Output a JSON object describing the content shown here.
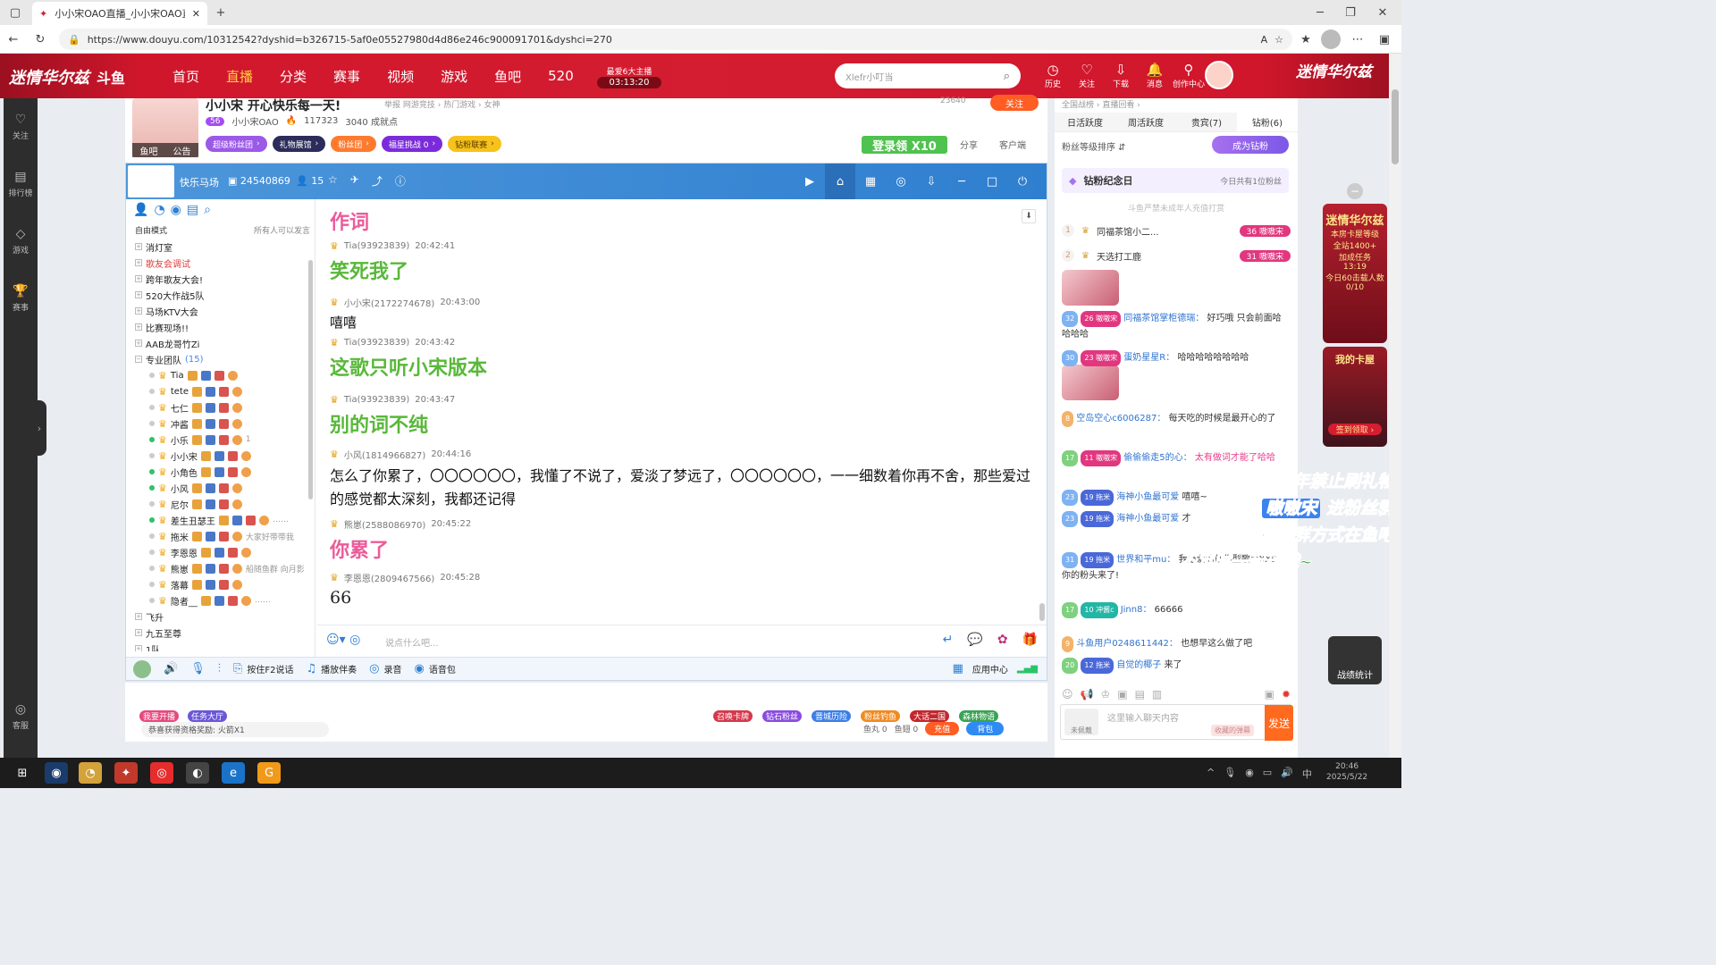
{
  "browser": {
    "tab_title": "小小宋OAO直播_小小宋OAO直播",
    "url": "https://www.douyu.com/10312542?dyshid=b326715-5af0e05527980d4d86e246c900091701&dyshci=270"
  },
  "header": {
    "banner_left": "迷情华尔兹",
    "logo": "斗鱼",
    "nav": [
      "首页",
      "直播",
      "分类",
      "赛事",
      "视频",
      "游戏",
      "鱼吧",
      "520"
    ],
    "active_nav": "直播",
    "timer_label": "最爱6大主播",
    "timer_value": "03:13:20",
    "search_placeholder": "Xlefr小叮当",
    "tools": [
      {
        "icon": "history-icon",
        "label": "历史"
      },
      {
        "icon": "heart-icon",
        "label": "关注"
      },
      {
        "icon": "download-icon",
        "label": "下载"
      },
      {
        "icon": "bell-icon",
        "label": "消息"
      },
      {
        "icon": "creator-icon",
        "label": "创作中心"
      }
    ],
    "banner_right": "迷情华尔兹"
  },
  "leftbar": [
    {
      "icon": "heart-icon",
      "label": "关注"
    },
    {
      "icon": "rank-icon",
      "label": "排行榜"
    },
    {
      "icon": "game-icon",
      "label": "游戏"
    },
    {
      "icon": "trophy-icon",
      "label": "赛事"
    },
    {
      "icon": "headset-icon",
      "label": "客服"
    }
  ],
  "room": {
    "title": "小小宋 开心快乐每一天!",
    "meta": "举报   网游竞技 › 热门游戏 › 女神",
    "host_level": "56",
    "host_name": "小小宋OAO",
    "heat": "117323",
    "achievements": "3040 成就点",
    "follow_count": "23640",
    "follow_label": "关注",
    "avatar_caption_left": "鱼吧",
    "avatar_caption_right": "公告",
    "pills": [
      "超级粉丝团",
      "礼物展馆",
      "粉丝团",
      "福星挑战  0",
      "钻粉联赛"
    ],
    "login_promo": "登录领 X10",
    "share": "分享",
    "service": "客户端"
  },
  "chatwin": {
    "room_name": "快乐马场",
    "room_id": "24540869",
    "member_count": "15",
    "mode_label": "自由模式",
    "mode_right": "所有人可以发言",
    "members": [
      {
        "name": "消灯室",
        "type": "folder"
      },
      {
        "name": "歌友会调试",
        "type": "folder",
        "red": true
      },
      {
        "name": "跨年歌友大会!",
        "type": "folder"
      },
      {
        "name": "520大作战5队",
        "type": "folder"
      },
      {
        "name": "马场KTV大会",
        "type": "folder"
      },
      {
        "name": "比赛现场!!",
        "type": "folder"
      },
      {
        "name": "AAB龙哥竹Zi",
        "type": "folder"
      },
      {
        "name": "专业团队",
        "type": "group",
        "count": "(15)"
      },
      {
        "name": "Tia",
        "online": false,
        "note": ""
      },
      {
        "name": "tete",
        "online": false,
        "note": ""
      },
      {
        "name": "七仁",
        "online": false,
        "note": ""
      },
      {
        "name": "冲酱",
        "online": false,
        "note": ""
      },
      {
        "name": "小乐",
        "online": true,
        "note": "1"
      },
      {
        "name": "小小宋",
        "online": false,
        "note": ""
      },
      {
        "name": "小角色",
        "online": true,
        "note": ""
      },
      {
        "name": "小风",
        "online": true,
        "note": ""
      },
      {
        "name": "尼尔",
        "online": false,
        "note": ""
      },
      {
        "name": "差生丑瑟王",
        "online": true,
        "note": "……"
      },
      {
        "name": "拖米",
        "online": false,
        "note": "大家好带带我"
      },
      {
        "name": "李恩恩",
        "online": false,
        "note": ""
      },
      {
        "name": "熊崽",
        "online": false,
        "note": "船随鱼群 向月影"
      },
      {
        "name": "落幕",
        "online": false,
        "note": ""
      },
      {
        "name": "隐者__",
        "online": false,
        "note": "……"
      },
      {
        "name": "飞升",
        "type": "folder"
      },
      {
        "name": "九五至尊",
        "type": "folder"
      },
      {
        "name": "1队",
        "type": "folder"
      }
    ],
    "messages": [
      {
        "user": "",
        "time": "",
        "text": "作词",
        "style": "pink"
      },
      {
        "user": "Tia(93923839)",
        "time": "20:42:41",
        "text": "笑死我了",
        "style": "green"
      },
      {
        "user": "小小宋(2172274678)",
        "time": "20:43:00",
        "text": "嘻嘻",
        "style": "plain"
      },
      {
        "user": "Tia(93923839)",
        "time": "20:43:42",
        "text": "这歌只听小宋版本",
        "style": "green"
      },
      {
        "user": "Tia(93923839)",
        "time": "20:43:47",
        "text": "别的词不纯",
        "style": "green"
      },
      {
        "user": "小风(1814966827)",
        "time": "20:44:16",
        "text": "怎么了你累了，〇〇〇〇〇〇，我懂了不说了，爱淡了梦远了，〇〇〇〇〇〇，一一细数着你再不舍，那些爱过的感觉都太深刻，我都还记得",
        "style": "long"
      },
      {
        "user": "熊崽(2588086970)",
        "time": "20:45:22",
        "text": "你累了",
        "style": "pink"
      },
      {
        "user": "李恩恩(2809467566)",
        "time": "20:45:28",
        "text": "66",
        "style": "x"
      }
    ],
    "input_placeholder": "说点什么吧...",
    "tools": [
      "按住F2说话",
      "播放伴奏",
      "录音",
      "语音包"
    ],
    "app_center": "应用中心"
  },
  "giftbar": {
    "left_buttons": [
      "我要开播",
      "任务大厅"
    ],
    "gifts": [
      "召唤卡牌",
      "钻石粉丝",
      "晋城历险",
      "粉丝钓鱼",
      "大话二国",
      "森林物语"
    ],
    "reward_text": "恭喜获得资格奖励: 火箭X1",
    "fish_balls": "鱼丸 0",
    "fish_fins": "鱼翅 0",
    "recharge": "充值",
    "backpack": "背包"
  },
  "rightpanel": {
    "top_links": "全国战榜 ›        直播回看 ›",
    "tabs": [
      "日活跃度",
      "周活跃度",
      "贵宾(7)",
      "钻粉(6)"
    ],
    "active_tab": "钻粉(6)",
    "sort_label": "粉丝等级排序 ⇵",
    "fan_btn": "成为钻粉",
    "day_title": "钻粉纪念日",
    "day_right": "今日共有1位粉丝",
    "minor_notice": "斗鱼严禁未成年人充值打赏",
    "ranks": [
      {
        "n": "1",
        "name": "同福茶馆小二...",
        "tag": "嗷嗷宋",
        "lv": "36"
      },
      {
        "n": "2",
        "name": "天选打工鹿",
        "tag": "嗷嗷宋",
        "lv": "31"
      }
    ],
    "chat": [
      {
        "lv": "32",
        "fan": "26 嗷嗷宋",
        "name": "同福茶馆掌柜德瑞：",
        "text": "好巧哦 只会前面哈哈哈哈"
      },
      {
        "lv": "30",
        "fan": "23 嗷嗷宋",
        "name": "蛋奶星星R：",
        "text": "哈哈哈哈哈哈哈哈"
      },
      {
        "lv": "8",
        "fan": "",
        "name": "空岛空心c6006287：",
        "text": "每天吃的时候是最开心的了"
      },
      {
        "lv": "17",
        "fan": "11 嗷嗷宋",
        "name": "偷偷偷走5的心：",
        "text": "太有做词才能了哈哈"
      },
      {
        "lv": "23",
        "fan": "19 拖米",
        "name": "海神小鱼最可爱",
        "text": "嘻嘻~"
      },
      {
        "lv": "23",
        "fan": "19 拖米",
        "name": "海神小鱼最可爱",
        "text": "才"
      },
      {
        "lv": "31",
        "fan": "19 拖米",
        "name": "世界和平mu：",
        "text": "我最爱的创作型歌手XXS，你的粉头来了!"
      },
      {
        "lv": "17",
        "fan": "10 冲酱c",
        "name": "Jinn8：",
        "text": "66666"
      },
      {
        "lv": "9",
        "fan": "",
        "name": "斗鱼用户0248611442：",
        "text": "也想早这么做了吧"
      },
      {
        "lv": "20",
        "fan": "12 拖米",
        "name": "自觉的椰子",
        "text": "来了"
      }
    ],
    "input_avatar": "未佩戴",
    "input_placeholder": "这里输入聊天内容",
    "input_barrage": "收藏的弹幕",
    "send": "发送"
  },
  "promo": {
    "line1": "未成年禁止刷礼物",
    "name": "嗷嗷宋",
    "line2": "进粉丝群",
    "line3": "进粉丝群方式在鱼吧",
    "line4": "不定时一起玩哦~"
  },
  "ads": {
    "ad1_title": "迷情华尔兹",
    "ad1_sub": "本房卡屋等级",
    "ad1_prog": "全站1400+",
    "ad1_task": "加成任务",
    "ad1_time": "13:19",
    "ad1_note": "今日60击载人数",
    "ad1_count": "0/10",
    "ad2_title": "我的卡屋",
    "ad2_btn": "签到领取 ›",
    "stats": "战绩统计"
  },
  "taskbar": {
    "time": "20:46",
    "date": "2025/5/22",
    "lang": "中"
  }
}
